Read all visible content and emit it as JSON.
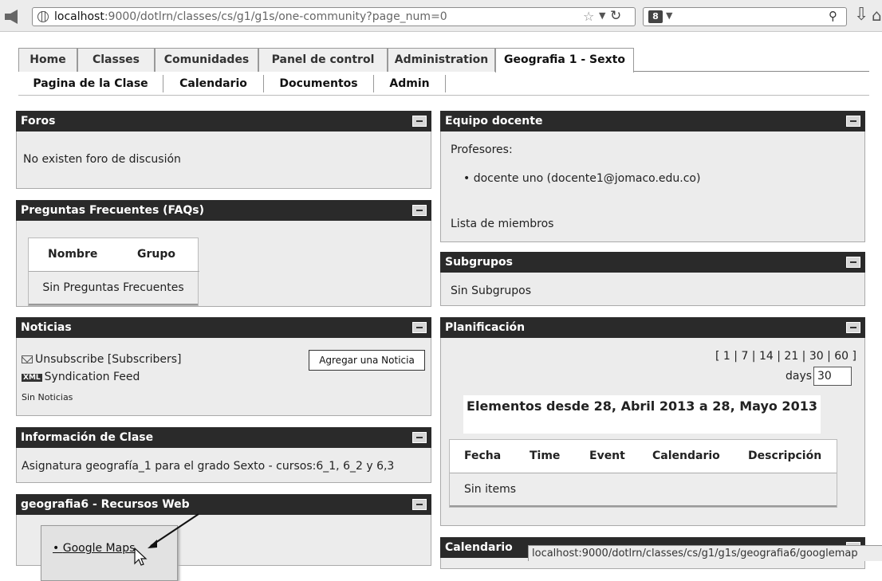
{
  "browser": {
    "url_host": "localhost",
    "url_rest": ":9000/dotlrn/classes/cs/g1/g1s/one-community?page_num=0",
    "search_engine": "8",
    "status_url": "localhost:9000/dotlrn/classes/cs/g1/g1s/geografia6/googlemap"
  },
  "tabs": [
    "Home",
    "Classes",
    "Comunidades",
    "Panel de control",
    "Administration",
    "Geografia 1 - Sexto"
  ],
  "subnav": [
    "Pagina de la Clase",
    "Calendario",
    "Documentos",
    "Admin"
  ],
  "foros": {
    "title": "Foros",
    "text": "No existen foro de discusión"
  },
  "faq": {
    "title": "Preguntas Frecuentes (FAQs)",
    "col_name": "Nombre",
    "col_group": "Grupo",
    "empty": "Sin Preguntas Frecuentes"
  },
  "noticias": {
    "title": "Noticias",
    "unsubscribe": "Unsubscribe [Subscribers]",
    "xml_badge": "XML",
    "syndication": "Syndication Feed",
    "empty": "Sin Noticias",
    "add_button": "Agregar una Noticia"
  },
  "info": {
    "title": "Información de Clase",
    "text": "Asignatura geografía_1 para el grado Sexto - cursos:6_1, 6_2 y 6,3"
  },
  "recursos": {
    "title": "geografia6 - Recursos Web",
    "link": "Google Maps"
  },
  "equipo": {
    "title": "Equipo docente",
    "profesores_label": "Profesores:",
    "profesor": "docente uno (docente1@jomaco.edu.co)",
    "miembros": "Lista de miembros"
  },
  "subgrupos": {
    "title": "Subgrupos",
    "text": "Sin Subgrupos"
  },
  "planificacion": {
    "title": "Planificación",
    "ranges": "[ 1 | 7 | 14 | 21 | 30 | 60 ]",
    "days_label": "days",
    "days_value": "30",
    "heading": "Elementos desde 28, Abril 2013 a 28, Mayo 2013",
    "columns": [
      "Fecha",
      "Time",
      "Event",
      "Calendario",
      "Descripción"
    ],
    "empty": "Sin items"
  },
  "calendario": {
    "title": "Calendario"
  }
}
